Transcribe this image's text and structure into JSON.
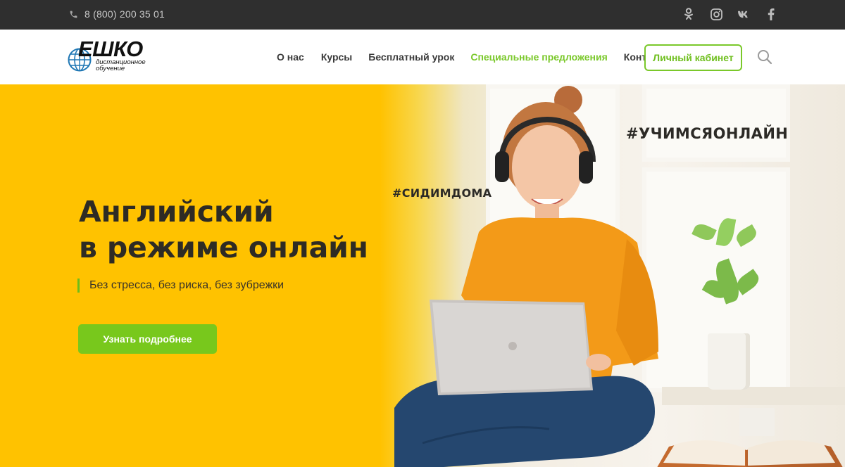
{
  "topbar": {
    "phone": "8 (800) 200 35 01",
    "socials": [
      {
        "icon": "odnoklassniki-icon"
      },
      {
        "icon": "instagram-icon"
      },
      {
        "icon": "vk-icon"
      },
      {
        "icon": "facebook-icon"
      }
    ]
  },
  "header": {
    "logo": {
      "word": "ЕШКО",
      "subtitle": "дистанционное\nобучение"
    },
    "nav": [
      {
        "label": "О нас",
        "active": false
      },
      {
        "label": "Курсы",
        "active": false
      },
      {
        "label": "Бесплатный урок",
        "active": false
      },
      {
        "label": "Специальные предложения",
        "active": true
      },
      {
        "label": "Контакты",
        "active": false
      }
    ],
    "cabinet_button": "Личный кабинет",
    "search_icon": "search-icon"
  },
  "hero": {
    "headline_line1": "Английский",
    "headline_line2": "в режиме онлайн",
    "subline": "Без стресса, без риска, без зубрежки",
    "cta": "Узнать подробнее",
    "tag_small": "#СИДИМДОМА",
    "tag_large": "#УЧИМСЯОНЛАЙН"
  },
  "colors": {
    "accent_green": "#7ac82a",
    "hero_yellow": "#ffc200",
    "topbar_bg": "#2f2f2f",
    "headline": "#2e2b24"
  }
}
